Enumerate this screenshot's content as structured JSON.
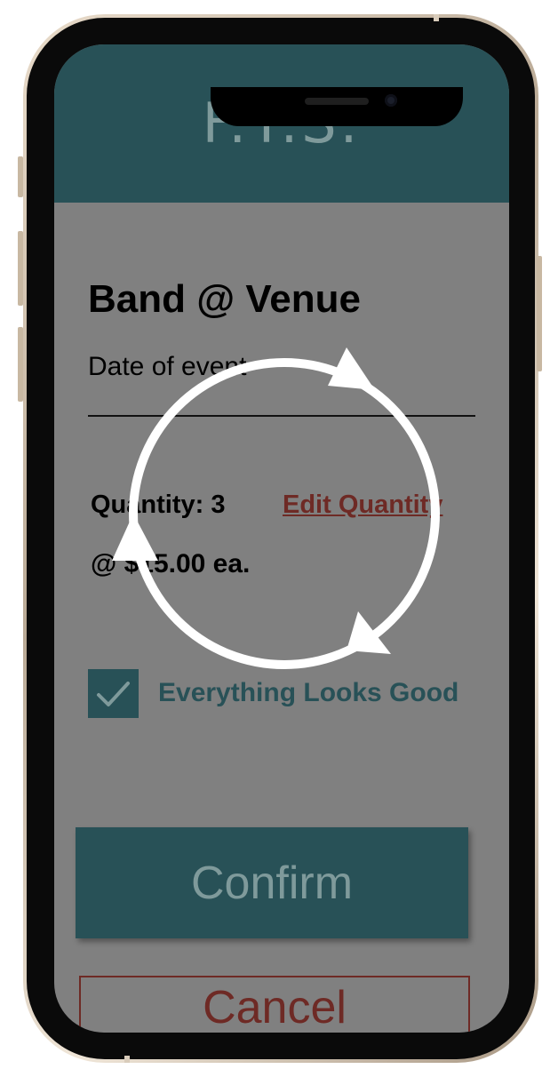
{
  "app": {
    "logo_text": "F.T.S."
  },
  "event": {
    "title": "Band @ Venue",
    "date_label": "Date of event"
  },
  "order": {
    "quantity_text": "Quantity: 3",
    "edit_quantity_label": "Edit Quantity",
    "price_text": "@ $15.00 ea."
  },
  "confirmation": {
    "checkbox_checked": true,
    "checkbox_label": "Everything Looks Good"
  },
  "actions": {
    "confirm_label": "Confirm",
    "cancel_label": "Cancel"
  },
  "overlay": {
    "icon": "refresh-loading-icon"
  },
  "colors": {
    "header": "#285157",
    "screen_overlay": "#808080",
    "accent_red": "#6e2a25",
    "muted_text": "#7f9a9b"
  }
}
